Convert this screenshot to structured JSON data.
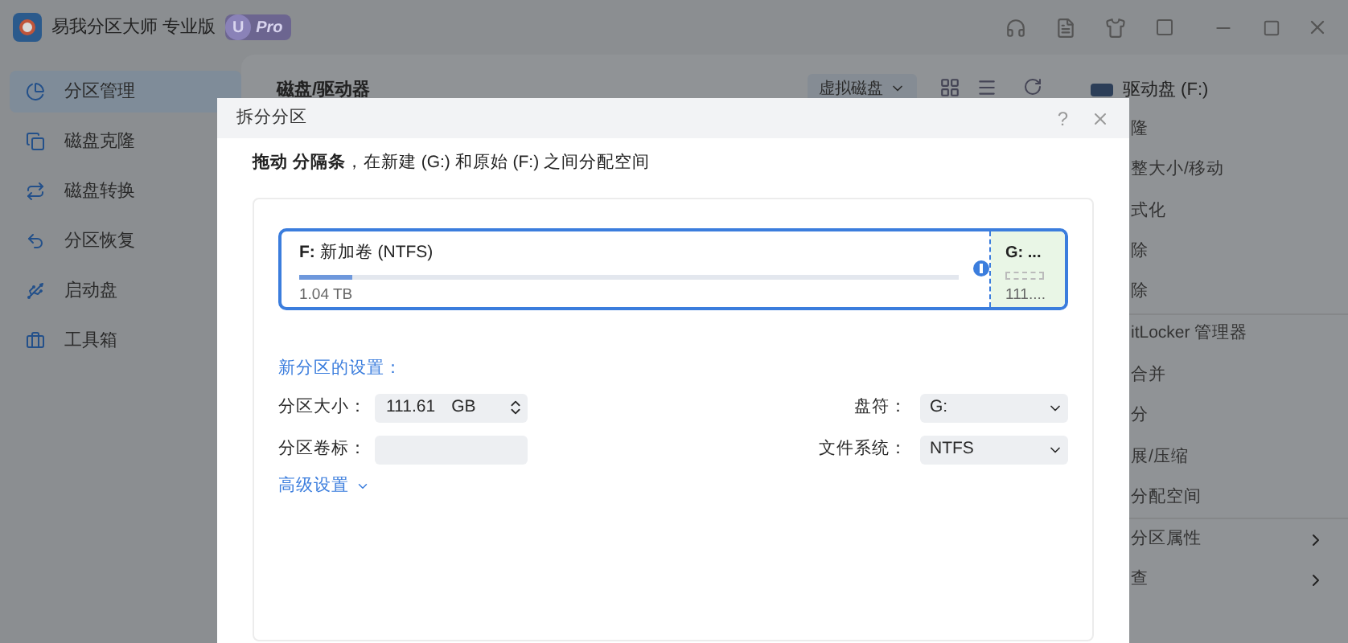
{
  "app": {
    "title": "易我分区大师 专业版",
    "badge_letter": "U",
    "badge": "Pro"
  },
  "sidebar": {
    "items": [
      {
        "label": "分区管理",
        "selected": true
      },
      {
        "label": "磁盘克隆",
        "selected": false
      },
      {
        "label": "磁盘转换",
        "selected": false
      },
      {
        "label": "分区恢复",
        "selected": false
      },
      {
        "label": "启动盘",
        "selected": false
      },
      {
        "label": "工具箱",
        "selected": false
      }
    ]
  },
  "main": {
    "heading": "磁盘/驱动器",
    "view_dropdown": "虚拟磁盘"
  },
  "right_panel": {
    "title": "驱动盘 (F:)",
    "items": [
      {
        "label": "隆",
        "divider_after": false,
        "submenu": false
      },
      {
        "label": "整大小/移动",
        "divider_after": false,
        "submenu": false
      },
      {
        "label": "式化",
        "divider_after": false,
        "submenu": false
      },
      {
        "label": "除",
        "divider_after": false,
        "submenu": false
      },
      {
        "label": "除",
        "divider_after": true,
        "submenu": false
      },
      {
        "label": "itLocker 管理器",
        "divider_after": false,
        "submenu": false
      },
      {
        "label": "合并",
        "divider_after": false,
        "submenu": false
      },
      {
        "label": "分",
        "divider_after": false,
        "submenu": false
      },
      {
        "label": "展/压缩",
        "divider_after": false,
        "submenu": false
      },
      {
        "label": "分配空间",
        "divider_after": true,
        "submenu": false
      },
      {
        "label": "分区属性",
        "divider_after": false,
        "submenu": true
      },
      {
        "label": "查",
        "divider_after": false,
        "submenu": true
      }
    ]
  },
  "dialog": {
    "title": "拆分分区",
    "help": "?",
    "instruction": "**拖动 分隔条**，在新建 (G:) 和原始 (F:) 之间分配空间",
    "original": {
      "letter": "F:",
      "name": "新加卷 (NTFS)",
      "size": "1.04 TB",
      "level": 0.08
    },
    "new": {
      "letter": "G: ...",
      "size": "111...."
    },
    "settings_title": "新分区的设置：",
    "size_label": "分区大小：",
    "size_value": "111.61",
    "size_unit": "GB",
    "volume_label": "分区卷标：",
    "drive_letter_label": "盘符：",
    "drive_letter": "G:",
    "fs_label": "文件系统：",
    "fs": "NTFS",
    "advanced": "高级设置"
  }
}
